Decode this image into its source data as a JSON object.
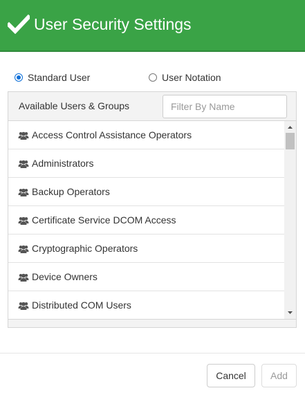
{
  "header": {
    "title": "User Security Settings",
    "icon": "check-icon",
    "background_color": "#3aa346"
  },
  "user_type": {
    "options": [
      {
        "label": "Standard User",
        "selected": true
      },
      {
        "label": "User Notation",
        "selected": false
      }
    ]
  },
  "panel": {
    "heading": "Available Users & Groups",
    "filter": {
      "placeholder": "Filter By Name",
      "value": ""
    },
    "items_icon": "users-icon",
    "items": [
      {
        "label": "Access Control Assistance Operators"
      },
      {
        "label": "Administrators"
      },
      {
        "label": "Backup Operators"
      },
      {
        "label": "Certificate Service DCOM Access"
      },
      {
        "label": "Cryptographic Operators"
      },
      {
        "label": "Device Owners"
      },
      {
        "label": "Distributed COM Users"
      }
    ]
  },
  "footer": {
    "cancel_label": "Cancel",
    "add_label": "Add",
    "add_enabled": false
  }
}
